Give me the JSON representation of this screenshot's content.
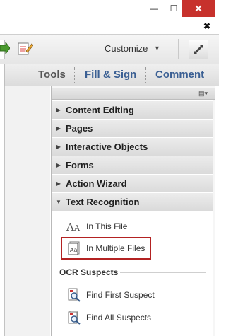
{
  "window": {
    "minimize": "—",
    "maximize": "☐",
    "close": "✕",
    "doc_close": "✖"
  },
  "toolbar": {
    "customize_label": "Customize",
    "customize_caret": "▼"
  },
  "tabs": {
    "tools": "Tools",
    "fill_sign": "Fill & Sign",
    "comment": "Comment"
  },
  "panel": {
    "options_glyph": "▤▾",
    "sections": [
      {
        "label": "Content Editing",
        "expanded": false
      },
      {
        "label": "Pages",
        "expanded": false
      },
      {
        "label": "Interactive Objects",
        "expanded": false
      },
      {
        "label": "Forms",
        "expanded": false
      },
      {
        "label": "Action Wizard",
        "expanded": false
      },
      {
        "label": "Text Recognition",
        "expanded": true
      }
    ],
    "text_recognition": {
      "in_this_file": "In This File",
      "in_multiple_files": "In Multiple Files",
      "ocr_suspects_heading": "OCR Suspects",
      "find_first_suspect": "Find First Suspect",
      "find_all_suspects": "Find All Suspects"
    }
  },
  "colors": {
    "tab_blue": "#3a5f93",
    "close_red": "#c7312c",
    "highlight_red": "#b32222"
  }
}
